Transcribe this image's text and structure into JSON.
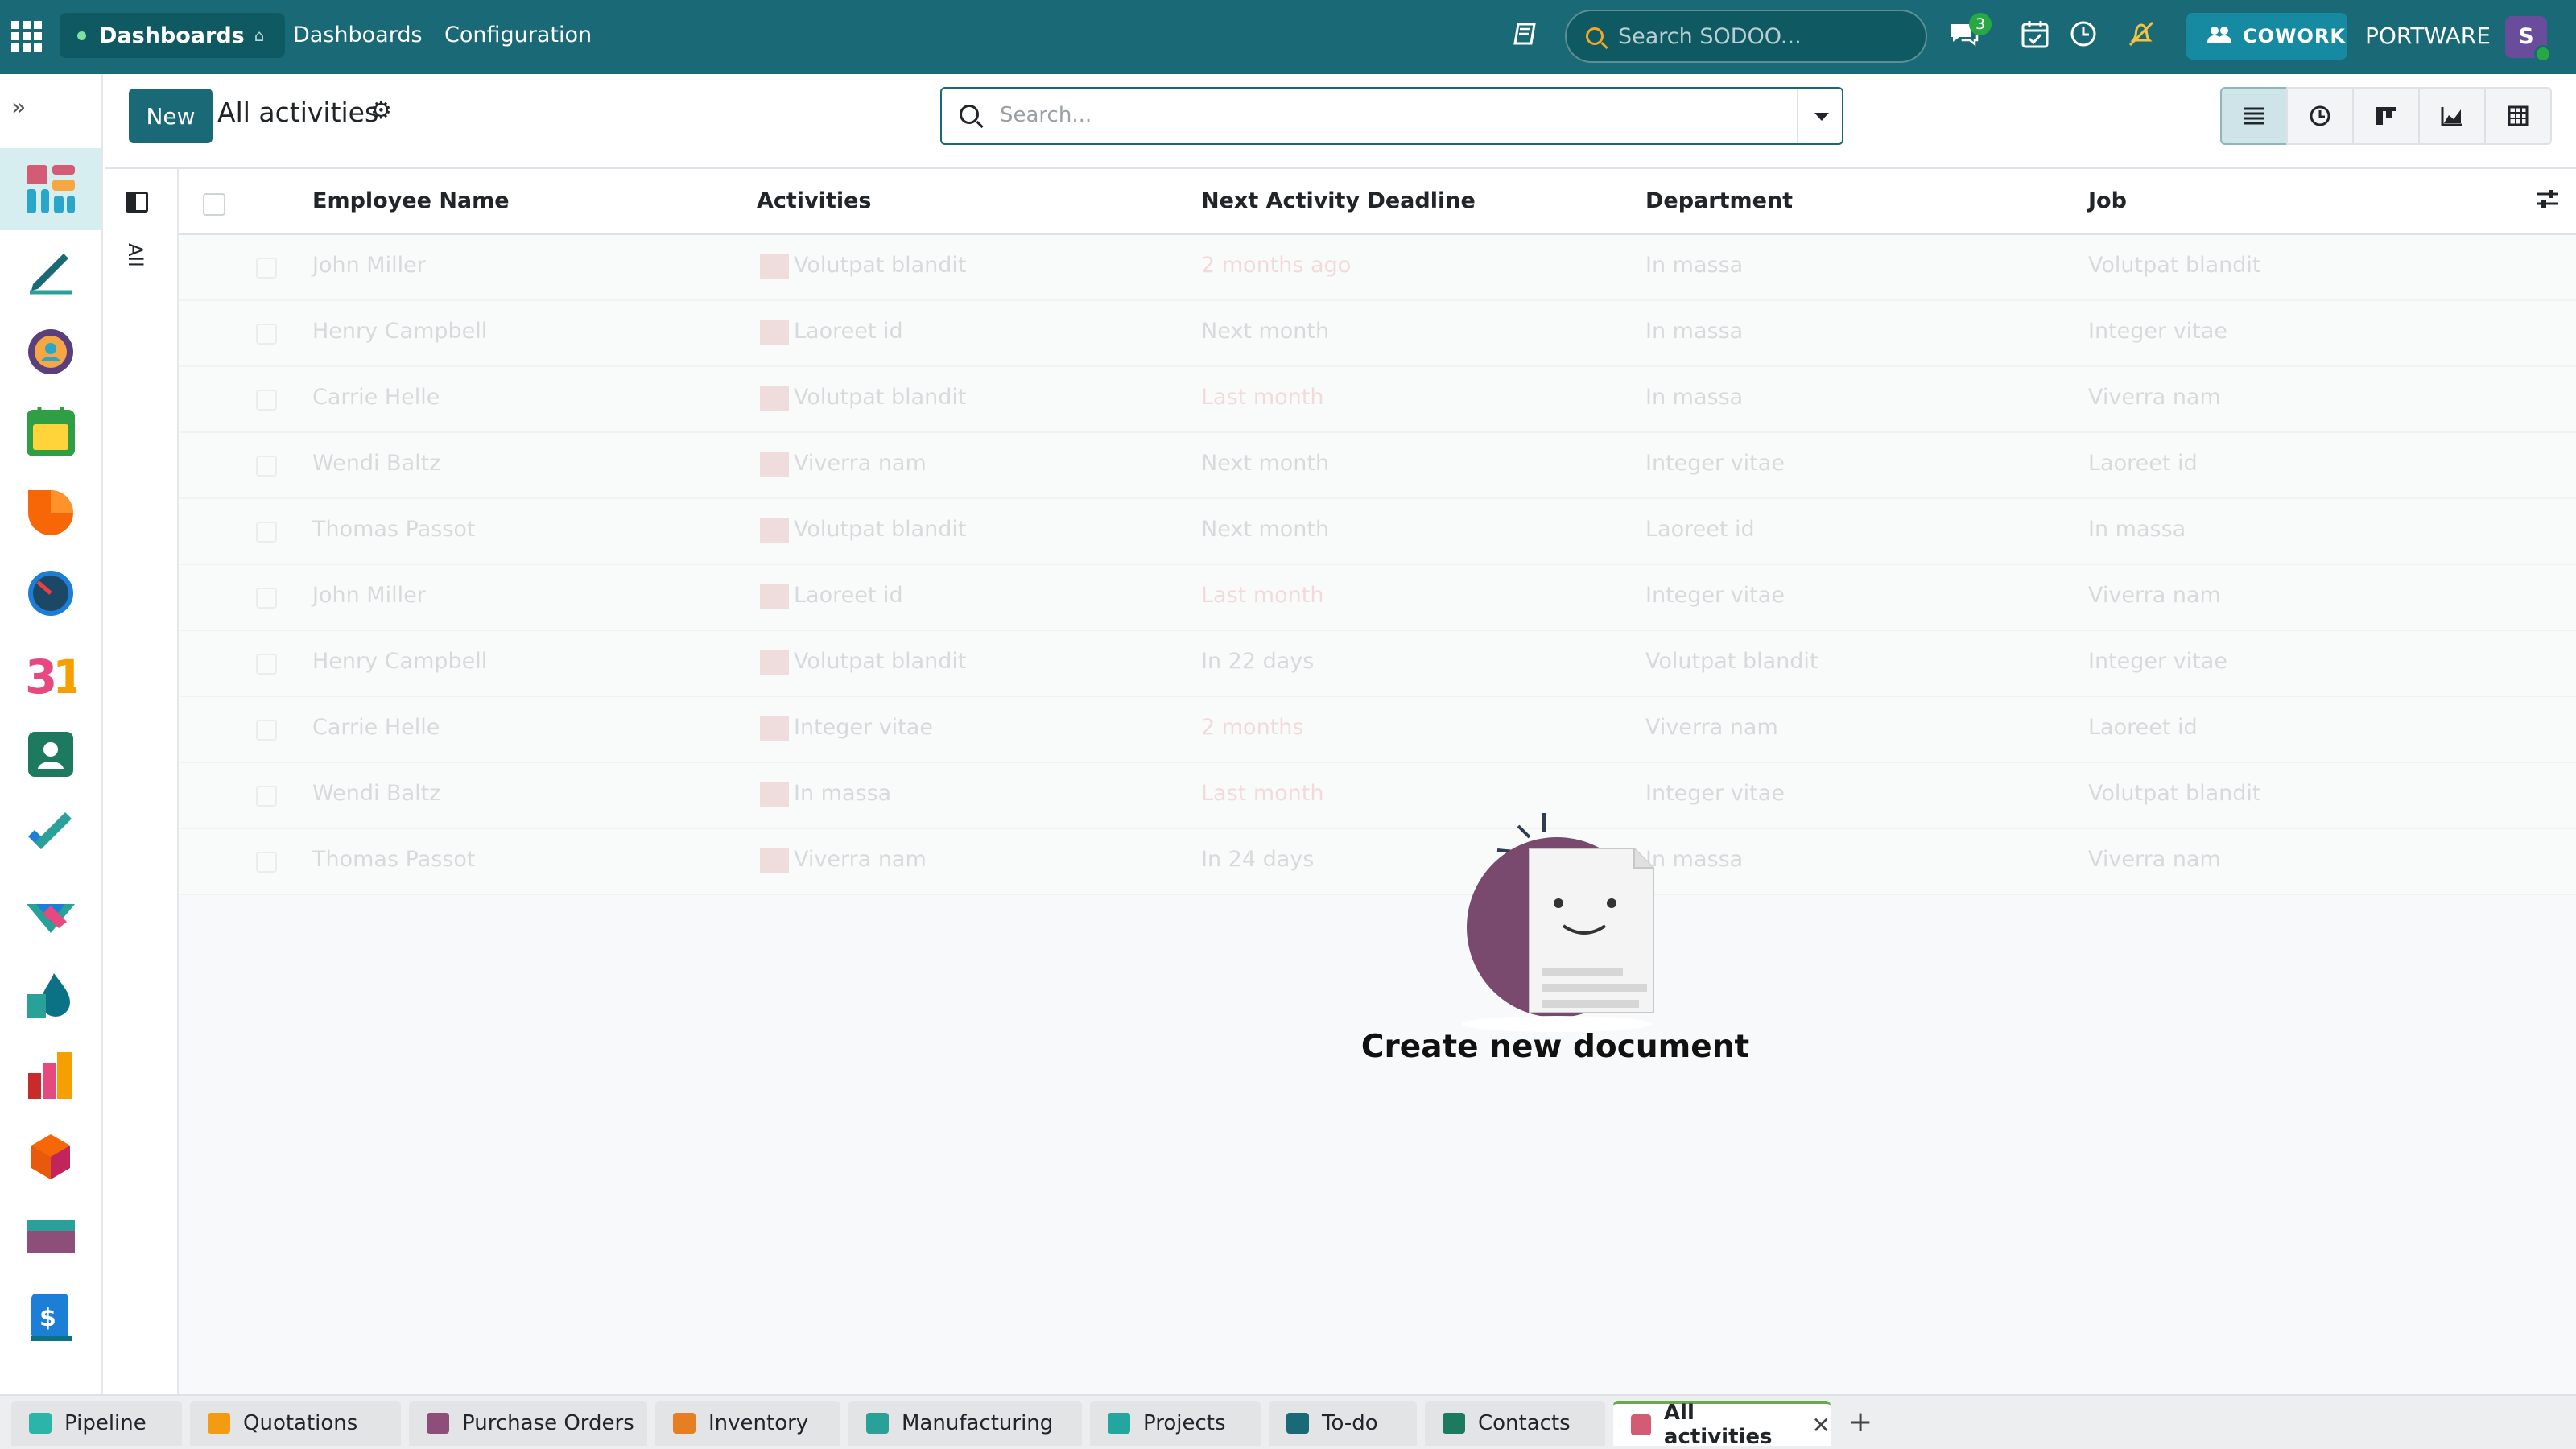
{
  "navbar": {
    "brand": "Dashboards",
    "menu": [
      "Dashboards",
      "Configuration"
    ],
    "search_placeholder": "Search SODOO...",
    "messages_badge": "3",
    "cowork_label": "COWORK",
    "company": "PORTWARE",
    "avatar_initial": "S"
  },
  "control_panel": {
    "new_label": "New",
    "title": "All activities",
    "search_placeholder": "Search..."
  },
  "side_panel": {
    "label": "All"
  },
  "table": {
    "columns": [
      "Employee Name",
      "Activities",
      "Next Activity Deadline",
      "Department",
      "Job"
    ],
    "rows": [
      {
        "name": "John Miller",
        "activity": "Volutpat blandit",
        "deadline": "2 months ago",
        "overdue": true,
        "department": "In massa",
        "job": "Volutpat blandit"
      },
      {
        "name": "Henry Campbell",
        "activity": "Laoreet id",
        "deadline": "Next month",
        "overdue": false,
        "department": "In massa",
        "job": "Integer vitae"
      },
      {
        "name": "Carrie Helle",
        "activity": "Volutpat blandit",
        "deadline": "Last month",
        "overdue": true,
        "department": "In massa",
        "job": "Viverra nam"
      },
      {
        "name": "Wendi Baltz",
        "activity": "Viverra nam",
        "deadline": "Next month",
        "overdue": false,
        "department": "Integer vitae",
        "job": "Laoreet id"
      },
      {
        "name": "Thomas Passot",
        "activity": "Volutpat blandit",
        "deadline": "Next month",
        "overdue": false,
        "department": "Laoreet id",
        "job": "In massa"
      },
      {
        "name": "John Miller",
        "activity": "Laoreet id",
        "deadline": "Last month",
        "overdue": true,
        "department": "Integer vitae",
        "job": "Viverra nam"
      },
      {
        "name": "Henry Campbell",
        "activity": "Volutpat blandit",
        "deadline": "In 22 days",
        "overdue": false,
        "department": "Volutpat blandit",
        "job": "Integer vitae"
      },
      {
        "name": "Carrie Helle",
        "activity": "Integer vitae",
        "deadline": "2 months",
        "overdue": true,
        "department": "Viverra nam",
        "job": "Laoreet id"
      },
      {
        "name": "Wendi Baltz",
        "activity": "In massa",
        "deadline": "Last month",
        "overdue": true,
        "department": "Integer vitae",
        "job": "Volutpat blandit"
      },
      {
        "name": "Thomas Passot",
        "activity": "Viverra nam",
        "deadline": "In 24 days",
        "overdue": false,
        "department": "In massa",
        "job": "Viverra nam"
      }
    ]
  },
  "empty_state": {
    "title": "Create new document"
  },
  "bottom_tabs": [
    {
      "label": "Pipeline",
      "icon": "pipeline-icon",
      "color": "#2bb5a8"
    },
    {
      "label": "Quotations",
      "icon": "quotations-icon",
      "color": "#f39c12"
    },
    {
      "label": "Purchase Orders",
      "icon": "purchase-icon",
      "color": "#8e4e7a"
    },
    {
      "label": "Inventory",
      "icon": "inventory-icon",
      "color": "#e67e22"
    },
    {
      "label": "Manufacturing",
      "icon": "manufacturing-icon",
      "color": "#2aa198"
    },
    {
      "label": "Projects",
      "icon": "projects-icon",
      "color": "#23a6a0"
    },
    {
      "label": "To-do",
      "icon": "todo-icon",
      "color": "#196a76"
    },
    {
      "label": "Contacts",
      "icon": "contacts-icon",
      "color": "#1d7a5f"
    },
    {
      "label": "All activities",
      "icon": "activities-icon",
      "color": "#d35b73",
      "active": true
    }
  ],
  "colors": {
    "navbar": "#196a76",
    "accent": "#196a76",
    "overdue": "#d9534f",
    "online": "#28a745"
  }
}
